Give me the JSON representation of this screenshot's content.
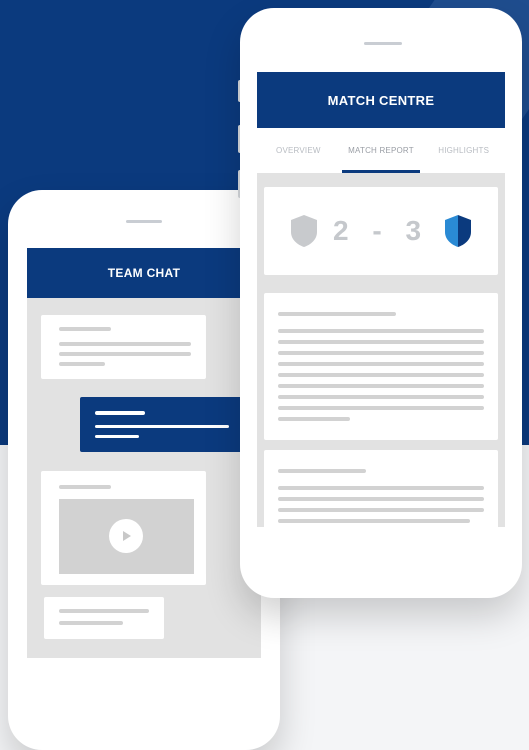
{
  "team_chat": {
    "title": "TEAM CHAT",
    "icons": {
      "video_play": "play-icon"
    }
  },
  "match_centre": {
    "title": "MATCH CENTRE",
    "tabs": [
      {
        "label": "OVERVIEW",
        "active": false
      },
      {
        "label": "MATCH REPORT",
        "active": true
      },
      {
        "label": "HIGHLIGHTS",
        "active": false
      }
    ],
    "score": {
      "home": "2",
      "separator": "-",
      "away": "3"
    },
    "icons": {
      "home_crest": "shield-icon",
      "away_crest": "shield-icon"
    }
  },
  "colors": {
    "brand_navy": "#0b3a7e",
    "accent_blue": "#2a8ad4",
    "placeholder_gray": "#d2d2d2",
    "screen_bg": "#e2e2e2"
  }
}
